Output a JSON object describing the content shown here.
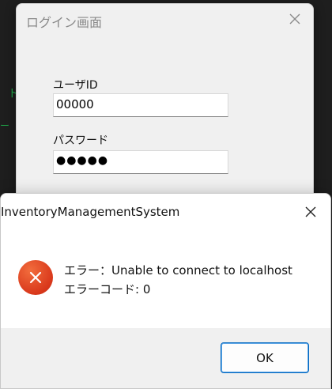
{
  "login": {
    "title": "ログイン画面",
    "user_label": "ユーザID",
    "user_value": "00000",
    "password_label": "パスワード",
    "password_value": "●●●●●"
  },
  "background": {
    "glyph1": "ト",
    "glyph2": "ー"
  },
  "error_dialog": {
    "title": "InventoryManagementSystem",
    "message_line1": "エラー：Unable to connect to localhost",
    "message_line2": "エラーコード: 0",
    "ok_label": "OK",
    "icon": "error-icon",
    "icon_color": "#d9381b",
    "accent_color": "#0067c0"
  }
}
